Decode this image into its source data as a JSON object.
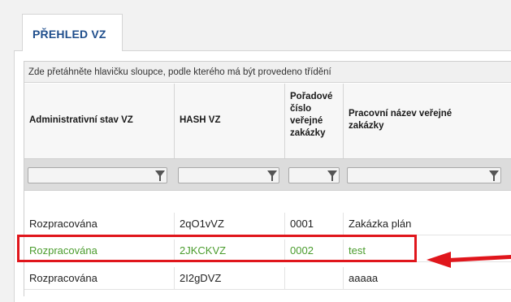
{
  "tab": {
    "label": "PŘEHLED VZ"
  },
  "grid": {
    "group_hint": "Zde přetáhněte hlavičku sloupce, podle kterého má být provedeno třídění",
    "columns": [
      {
        "lines": [
          "Administrativní stav VZ"
        ]
      },
      {
        "lines": [
          "HASH VZ"
        ]
      },
      {
        "lines": [
          "Pořadové",
          "číslo",
          "veřejné",
          "zakázky"
        ]
      },
      {
        "lines": [
          "Pracovní název veřejné",
          "zakázky"
        ]
      }
    ],
    "rows": [
      {
        "cells": [
          "Rozpracována",
          "2qO1vVZ",
          "0001",
          "Zakázka plán"
        ],
        "selected": false
      },
      {
        "cells": [
          "Rozpracována",
          "2JKCKVZ",
          "0002",
          "test"
        ],
        "selected": true
      },
      {
        "cells": [
          "Rozpracována",
          "2I2gDVZ",
          "",
          "aaaaa"
        ],
        "selected": false
      }
    ]
  },
  "colors": {
    "selected_text": "#4a9c2d",
    "highlight": "#e0161c",
    "tab_text": "#1f4e8c"
  }
}
